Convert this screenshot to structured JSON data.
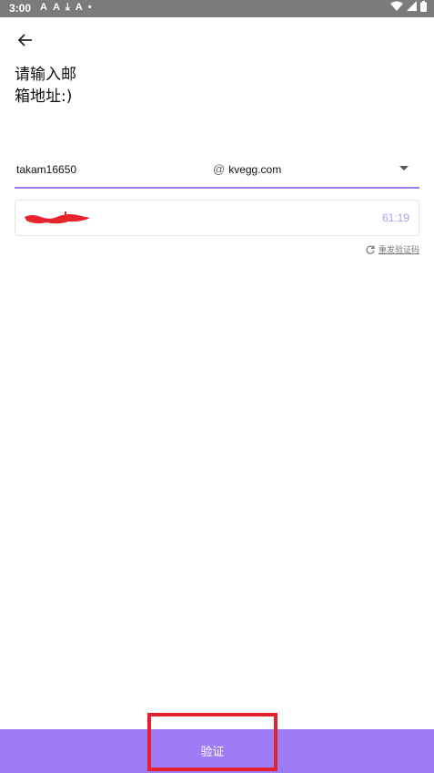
{
  "status_bar": {
    "time": "3:00",
    "left_icons": [
      "A",
      "A",
      "download-icon",
      "A",
      "dot"
    ],
    "right_icons": [
      "wifi-icon",
      "signal-icon",
      "battery-icon"
    ]
  },
  "header": {
    "back_icon": "arrow-left-icon",
    "title_line1": "请输入邮",
    "title_line2": "箱地址:)"
  },
  "email": {
    "username": "takam16650",
    "at_symbol": "@",
    "domain": "kvegg.com",
    "dropdown_icon": "caret-down-icon"
  },
  "mail_item": {
    "sender_redacted": true,
    "time": "61:19"
  },
  "resend": {
    "icon": "refresh-icon",
    "label": "重发验证码"
  },
  "footer": {
    "verify_label": "验证"
  },
  "colors": {
    "accent": "#9f7cf7",
    "highlight_border": "#e3212f",
    "status_bar": "#7b7b7b"
  }
}
